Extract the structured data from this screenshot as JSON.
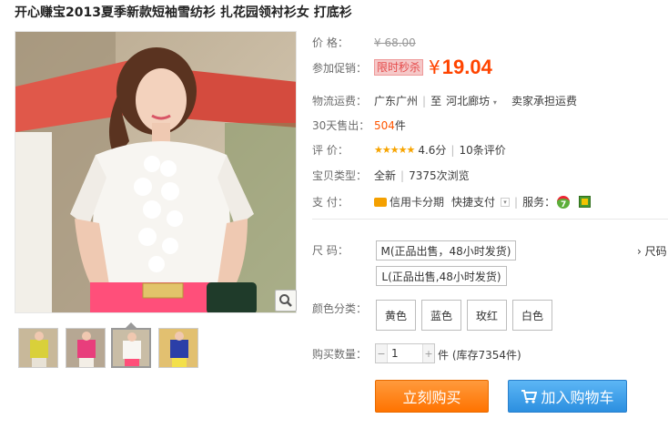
{
  "title": "开心赚宝2013夏季新款短袖雪纺衫 扎花园领衬衫女 打底衫",
  "price": {
    "label": "价  格：",
    "original": "¥ 68.00"
  },
  "promo": {
    "label": "参加促销：",
    "tag": "限时秒杀",
    "yen": "¥",
    "price": "19.04"
  },
  "shipping": {
    "label": "物流运费：",
    "from": "广东广州",
    "sep": "至",
    "to": "河北廊坊",
    "fee": "卖家承担运费"
  },
  "sales": {
    "label": "30天售出：",
    "count": "504",
    "unit": "件"
  },
  "rating": {
    "label": "评  价：",
    "stars": 4.6,
    "score": "4.6分",
    "reviews": "10条评价"
  },
  "item_type": {
    "label": "宝贝类型：",
    "condition": "全新",
    "views": "7375次浏览"
  },
  "payment": {
    "label": "支  付：",
    "installment": "信用卡分期",
    "quickpay": "快捷支付",
    "service_label": "服务："
  },
  "size": {
    "label": "尺  码：",
    "options": [
      "M(正品出售，48小时发货)",
      "L(正品出售,48小时发货)"
    ],
    "guide": "› 尺码"
  },
  "color": {
    "label": "颜色分类：",
    "options": [
      "黄色",
      "蓝色",
      "玫红",
      "白色"
    ]
  },
  "quantity": {
    "label": "购买数量：",
    "value": "1",
    "stock": "件 (库存7354件)"
  },
  "buttons": {
    "buy": "立刻购买",
    "cart": "加入购物车"
  },
  "colors": {
    "accent": "#ff4400",
    "buy": "#ff7300",
    "cart": "#2c8fe0"
  }
}
